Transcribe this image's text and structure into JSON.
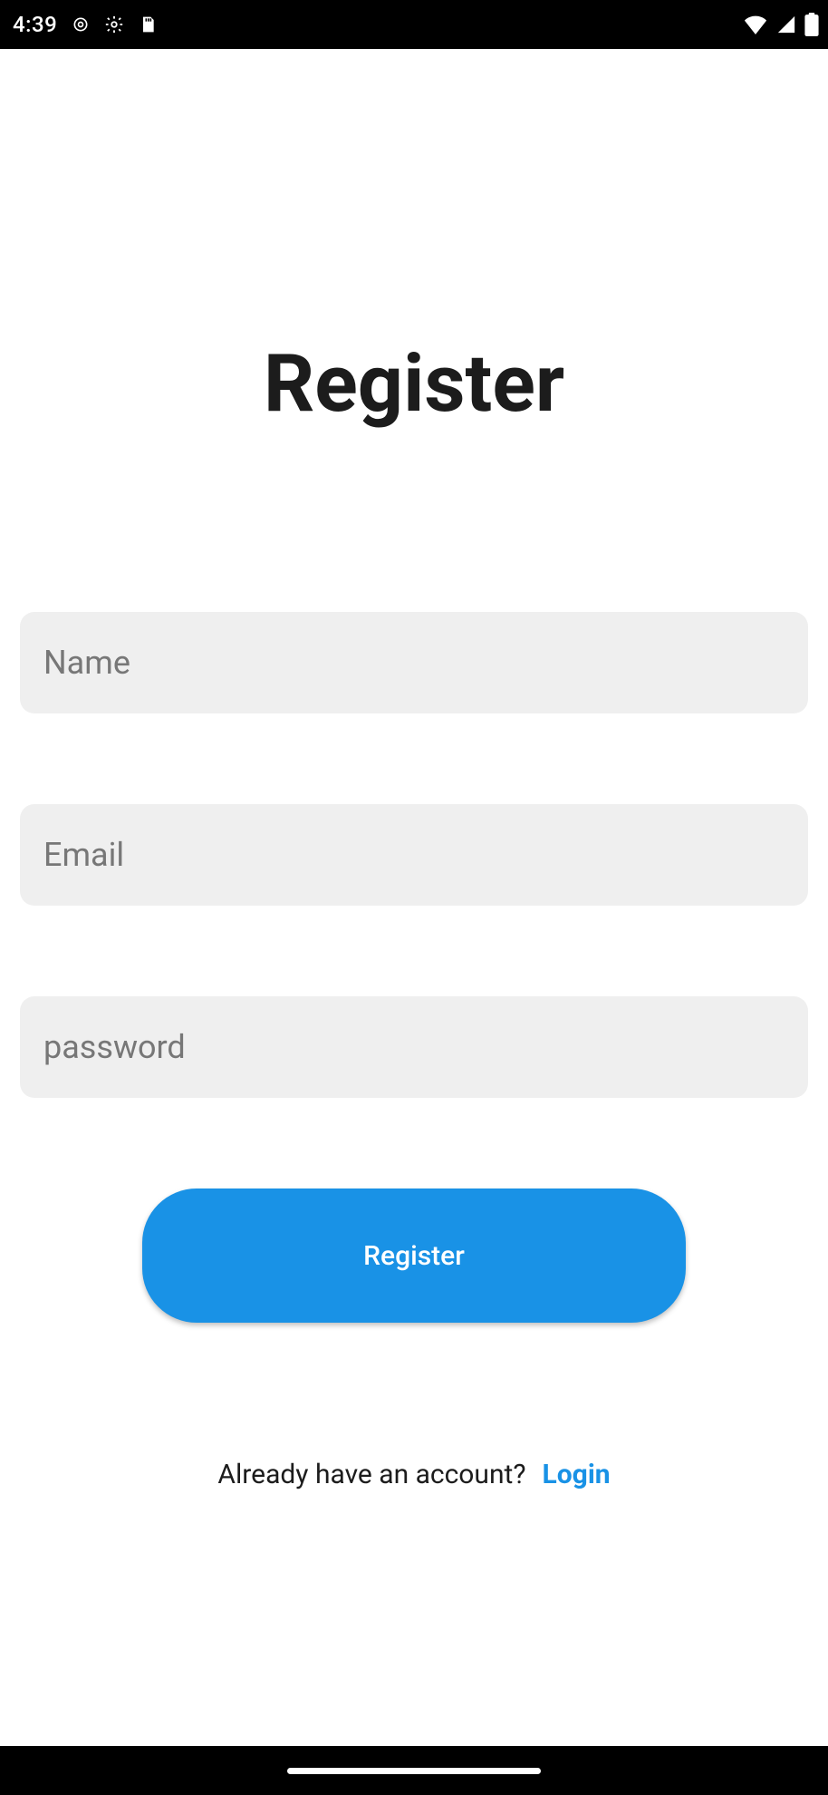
{
  "status_bar": {
    "time": "4:39",
    "icons_left": [
      "voice-icon",
      "gear-icon",
      "sd-card-icon"
    ],
    "icons_right": [
      "wifi-icon",
      "signal-icon",
      "battery-icon"
    ]
  },
  "page": {
    "title": "Register",
    "name_placeholder": "Name",
    "email_placeholder": "Email",
    "password_placeholder": "password",
    "name_value": "",
    "email_value": "",
    "password_value": "",
    "register_button": "Register",
    "already_text": "Already have an account?",
    "login_link": "Login"
  },
  "colors": {
    "accent": "#1992e6",
    "input_bg": "#efefef",
    "text": "#1c1c1c"
  }
}
